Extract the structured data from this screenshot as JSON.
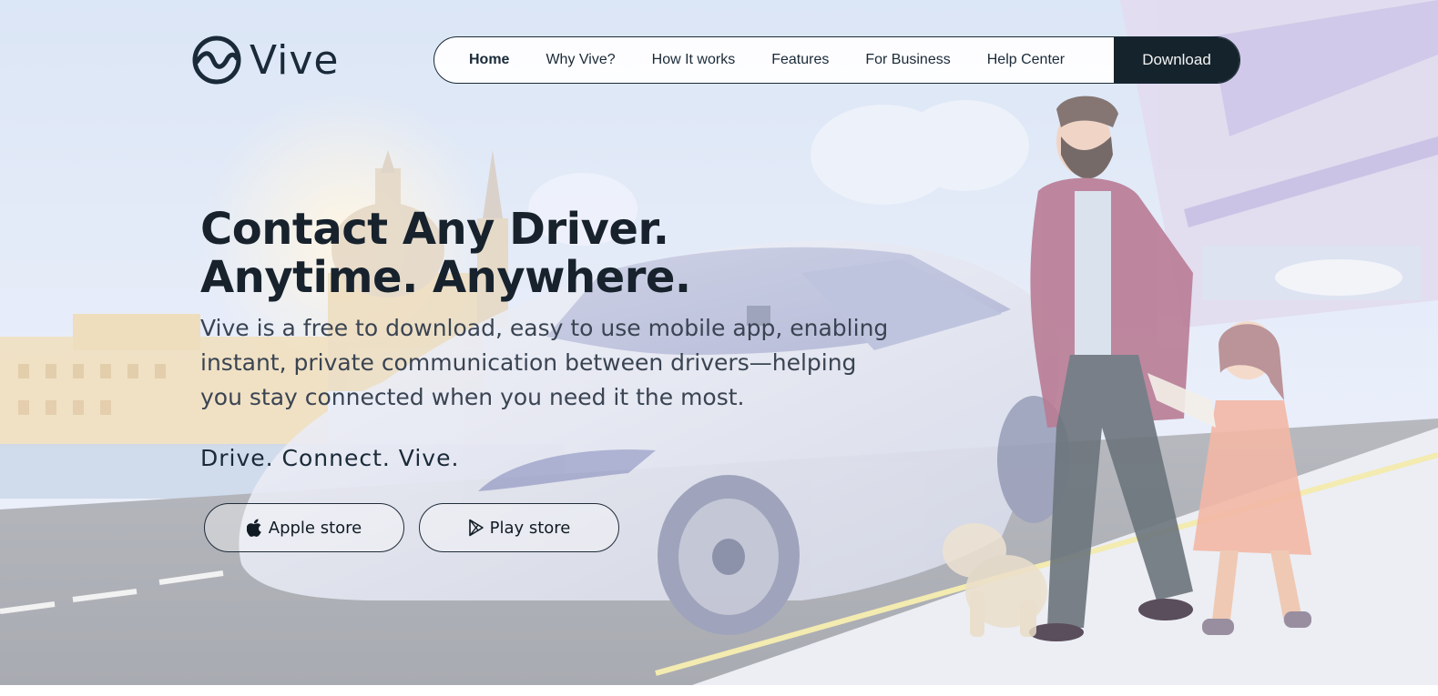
{
  "brand": {
    "name": "Vive",
    "text_color": "#1a2a38"
  },
  "nav": {
    "items": [
      {
        "label": "Home",
        "active": true
      },
      {
        "label": "Why Vive?",
        "active": false
      },
      {
        "label": "How It works",
        "active": false
      },
      {
        "label": "Features",
        "active": false
      },
      {
        "label": "For Business",
        "active": false
      },
      {
        "label": "Help Center",
        "active": false
      }
    ],
    "download_label": "Download",
    "download_bg": "#15232c"
  },
  "hero": {
    "headline": "Contact Any Driver. Anytime. Anywhere.",
    "subtext": "Vive is a free to download, easy to use mobile app, enabling instant, private communication between drivers—helping you stay connected when you need it the most.",
    "tagline": "Drive. Connect. Vive.",
    "illustration": "city-street-car-father-daughter-dog"
  },
  "stores": {
    "apple_label": "Apple store",
    "apple_icon": "apple-icon",
    "play_label": "Play store",
    "play_icon": "play-store-icon"
  }
}
